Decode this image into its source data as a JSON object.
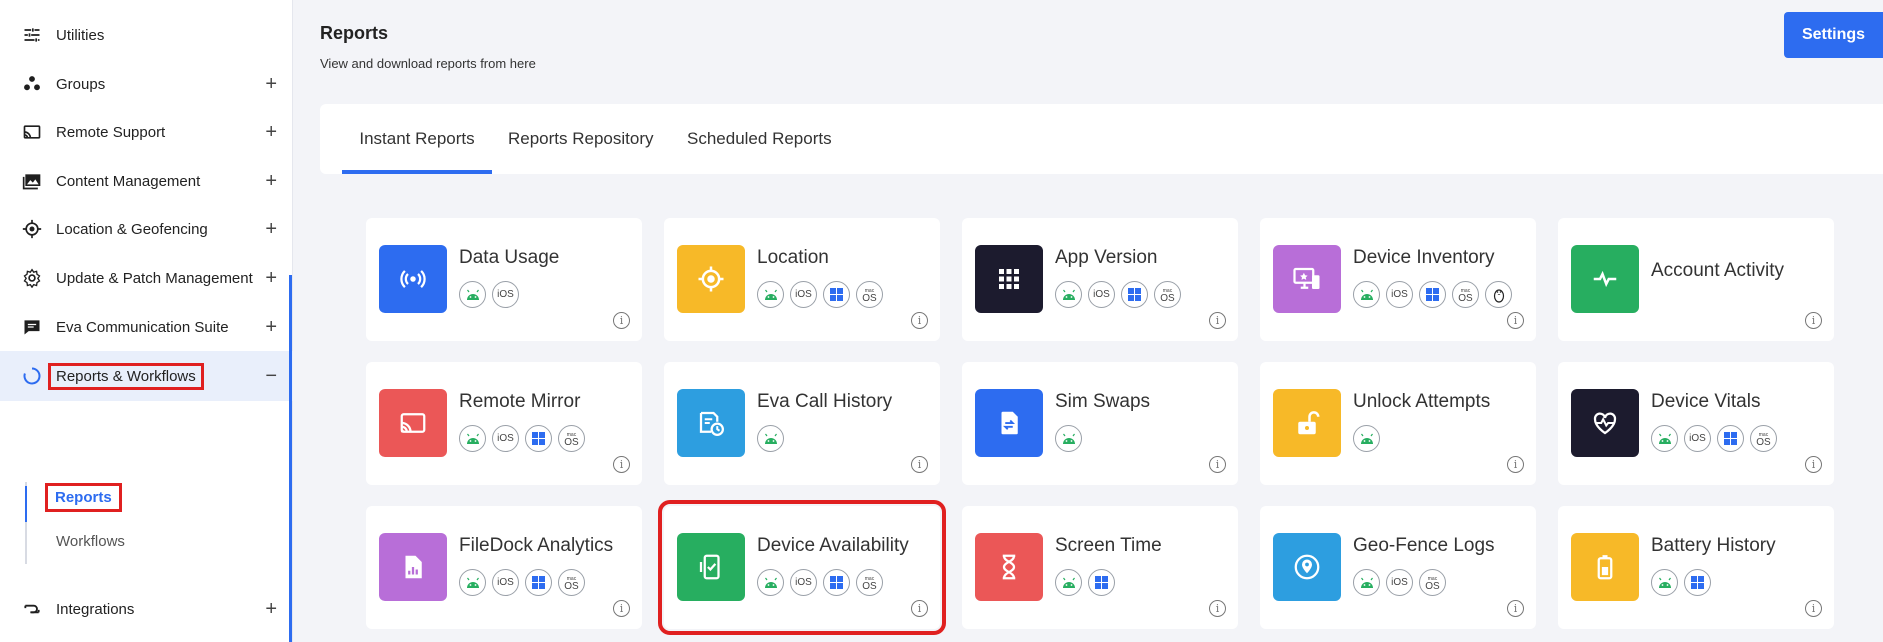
{
  "sidebar": {
    "items": [
      {
        "label": "Utilities",
        "icon": "sliders-icon",
        "plus": ""
      },
      {
        "label": "Groups",
        "icon": "groups-icon",
        "plus": "+"
      },
      {
        "label": "Remote Support",
        "icon": "cast-icon",
        "plus": "+"
      },
      {
        "label": "Content Management",
        "icon": "images-icon",
        "plus": "+"
      },
      {
        "label": "Location & Geofencing",
        "icon": "location-target-icon",
        "plus": "+"
      },
      {
        "label": "Update & Patch Management",
        "icon": "gear-icon",
        "plus": "+"
      },
      {
        "label": "Eva Communication Suite",
        "icon": "chat-icon",
        "plus": "+"
      },
      {
        "label": "Reports & Workflows",
        "icon": "circle-progress-icon",
        "plus": "−"
      },
      {
        "label": "Integrations",
        "icon": "integrations-icon",
        "plus": "+"
      }
    ],
    "sub": {
      "reports": "Reports",
      "workflows": "Workflows"
    }
  },
  "header": {
    "title": "Reports",
    "subtitle": "View and download reports from here",
    "settings_label": "Settings"
  },
  "tabs": [
    "Instant Reports",
    "Reports Repository",
    "Scheduled Reports"
  ],
  "colors": {
    "blue": "#2d6cf0",
    "yellow": "#f7b928",
    "dark": "#1c1b2e",
    "purple": "#b86ed8",
    "green": "#27ae60",
    "red": "#eb5757",
    "lightblue": "#2d9ee0"
  },
  "cards": [
    {
      "name": "Data Usage",
      "icon": "broadcast-icon",
      "color": "#2d6cf0",
      "os": [
        "android",
        "ios"
      ]
    },
    {
      "name": "Location",
      "icon": "crosshair-icon",
      "color": "#f7b928",
      "os": [
        "android",
        "ios",
        "windows",
        "macos"
      ]
    },
    {
      "name": "App Version",
      "icon": "grid-icon",
      "color": "#1c1b2e",
      "os": [
        "android",
        "ios",
        "windows",
        "macos"
      ]
    },
    {
      "name": "Device Inventory",
      "icon": "devices-icon",
      "color": "#b86ed8",
      "os": [
        "android",
        "ios",
        "windows",
        "macos",
        "linux"
      ]
    },
    {
      "name": "Account Activity",
      "icon": "pulse-icon",
      "color": "#27ae60",
      "os": []
    },
    {
      "name": "Remote Mirror",
      "icon": "cast-icon",
      "color": "#eb5757",
      "os": [
        "android",
        "ios",
        "windows",
        "macos"
      ]
    },
    {
      "name": "Eva Call History",
      "icon": "call-history-icon",
      "color": "#2d9ee0",
      "os": [
        "android"
      ]
    },
    {
      "name": "Sim Swaps",
      "icon": "sim-icon",
      "color": "#2d6cf0",
      "os": [
        "android"
      ]
    },
    {
      "name": "Unlock Attempts",
      "icon": "unlock-icon",
      "color": "#f7b928",
      "os": [
        "android"
      ]
    },
    {
      "name": "Device Vitals",
      "icon": "heart-pulse-icon",
      "color": "#1c1b2e",
      "os": [
        "android",
        "ios",
        "windows",
        "macos"
      ]
    },
    {
      "name": "FileDock Analytics",
      "icon": "file-chart-icon",
      "color": "#b86ed8",
      "os": [
        "android",
        "ios",
        "windows",
        "macos"
      ]
    },
    {
      "name": "Device Availability",
      "icon": "phone-check-icon",
      "color": "#27ae60",
      "os": [
        "android",
        "ios",
        "windows",
        "macos"
      ]
    },
    {
      "name": "Screen Time",
      "icon": "hourglass-icon",
      "color": "#eb5757",
      "os": [
        "android",
        "windows"
      ]
    },
    {
      "name": "Geo-Fence Logs",
      "icon": "geofence-icon",
      "color": "#2d9ee0",
      "os": [
        "android",
        "ios",
        "macos"
      ]
    },
    {
      "name": "Battery History",
      "icon": "battery-icon",
      "color": "#f7b928",
      "os": [
        "android",
        "windows"
      ]
    }
  ],
  "os_labels": {
    "ios": "iOS",
    "mac_top": "mac",
    "mac_bottom": "OS",
    "info": "i"
  }
}
